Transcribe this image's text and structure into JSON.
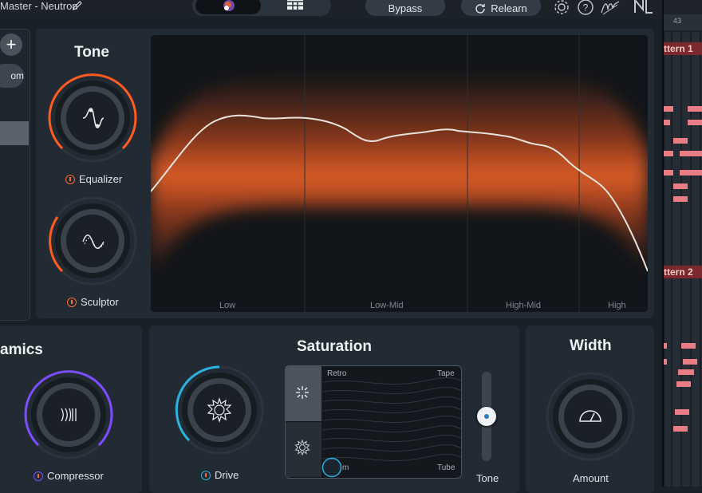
{
  "topbar": {
    "title": "Master - Neutron",
    "bypass_label": "Bypass",
    "relearn_label": "Relearn"
  },
  "left_panel": {
    "add_label": "+",
    "zoom_label": "om"
  },
  "tone": {
    "title": "Tone",
    "equalizer_label": "Equalizer",
    "sculptor_label": "Sculptor",
    "bands": [
      "Low",
      "Low-Mid",
      "High-Mid",
      "High"
    ]
  },
  "dynamics": {
    "title": "amics",
    "compressor_label": "Compressor"
  },
  "saturation": {
    "title": "Saturation",
    "drive_label": "Drive",
    "xy_labels": {
      "top_left": "Retro",
      "top_right": "Tape",
      "bottom_left": "m",
      "bottom_right": "Tube"
    },
    "tone_label": "Tone"
  },
  "width": {
    "title": "Width",
    "amount_label": "Amount"
  },
  "daw": {
    "ruler_number": "43",
    "pattern1": "ttern 1",
    "pattern2": "ttern 2"
  },
  "colors": {
    "tone_accent": "#ff5a1f",
    "dynamics_accent": "#7b4dff",
    "saturation_accent": "#2bb3e0",
    "note_color": "#e87d86"
  }
}
